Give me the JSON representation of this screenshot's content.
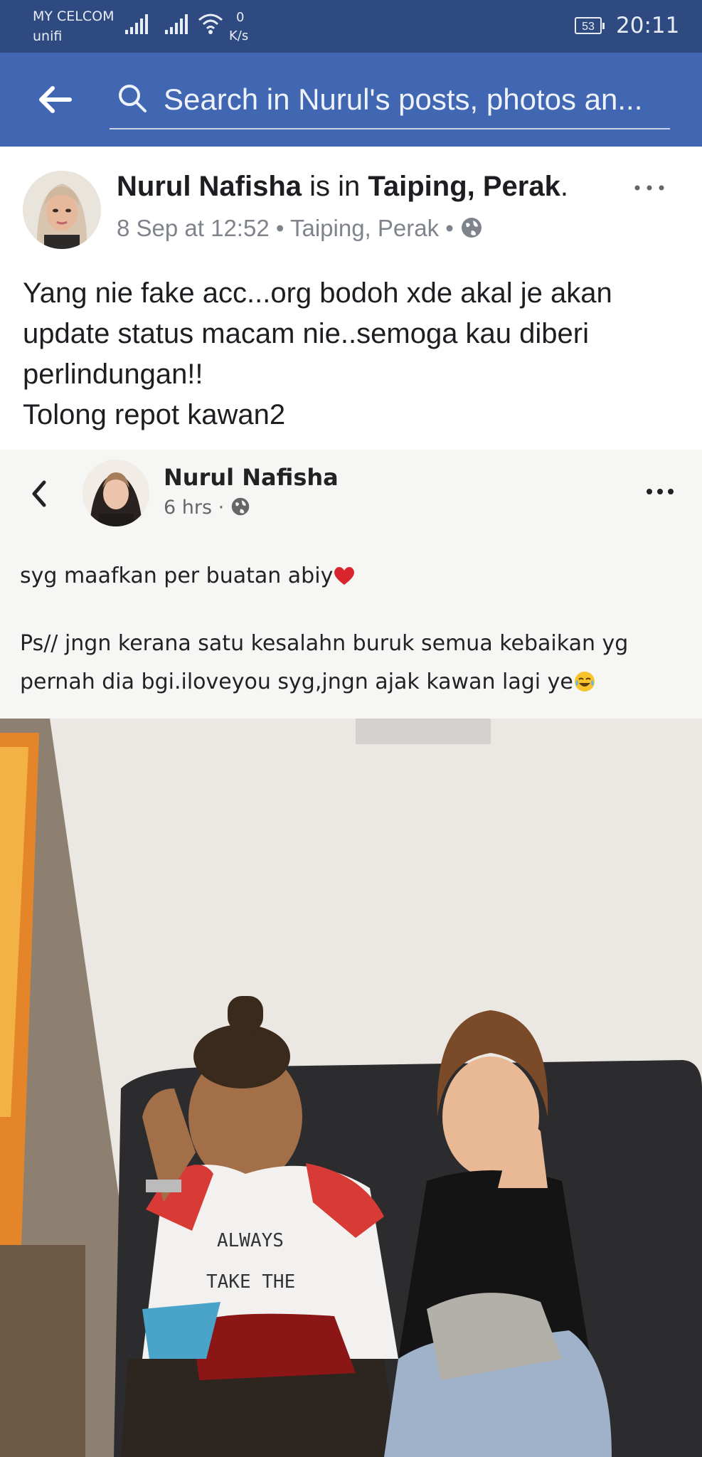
{
  "status_bar": {
    "carrier": "MY CELCOM",
    "wifi_name": "unifi",
    "speed_value": "0",
    "speed_unit": "K/s",
    "battery": "53",
    "time": "20:11"
  },
  "header": {
    "back_icon": "back-arrow-icon",
    "search_icon": "search-icon",
    "search_placeholder": "Search in Nurul's posts, photos an..."
  },
  "post": {
    "author": "Nurul Nafisha",
    "is_in": " is in ",
    "location_bold": "Taiping, Perak",
    "period": ".",
    "date": "8 Sep at 12:52",
    "sep": " • ",
    "location": "Taiping, Perak",
    "privacy_icon": "globe-icon",
    "more_icon": "more-options-icon",
    "text_lines": [
      "Yang nie fake acc...org bodoh xde akal je akan",
      "update status macam nie..semoga kau diberi",
      "perlindungan!!",
      "Tolong repot kawan2"
    ]
  },
  "shared_post": {
    "back_icon": "chevron-left-icon",
    "author": "Nurul Nafisha",
    "time": "6 hrs · ",
    "privacy_icon": "globe-icon",
    "more_icon": "more-options-icon",
    "line1": "syg maafkan per buatan abiy",
    "line1_emoji": "red-heart-icon",
    "line2": "Ps// jngn kerana satu kesalahn buruk semua kebaikan yg pernah dia bgi.iloveyou syg,jngn ajak kawan lagi ye",
    "line2_emoji": "crying-laughing-icon",
    "photo_shirt_text_1": "ALWAYS",
    "photo_shirt_text_2": "TAKE THE"
  },
  "colors": {
    "status_bar": "#2f4a80",
    "header": "#4267b2",
    "text": "#1c1e21",
    "meta": "#7f848c"
  }
}
